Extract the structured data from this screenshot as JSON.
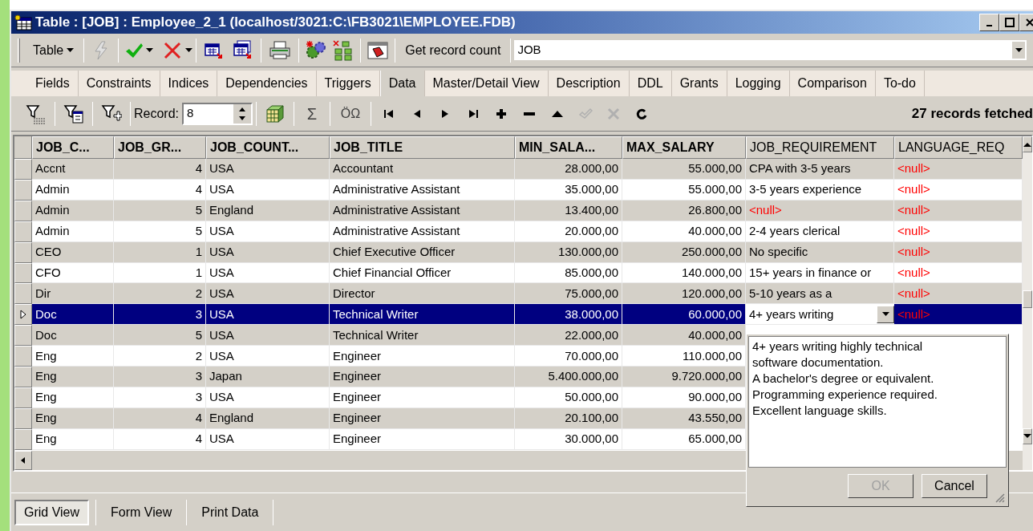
{
  "window": {
    "title": "Table : [JOB] : Employee_2_1 (localhost/3021:C:\\FB3021\\EMPLOYEE.FDB)"
  },
  "toolbar": {
    "table_menu": "Table",
    "lightning_disabled": true,
    "get_record_count": "Get record count",
    "table_select": "JOB"
  },
  "tabs": [
    {
      "label": "Fields",
      "selected": false
    },
    {
      "label": "Constraints",
      "selected": false
    },
    {
      "label": "Indices",
      "selected": false
    },
    {
      "label": "Dependencies",
      "selected": false
    },
    {
      "label": "Triggers",
      "selected": false
    },
    {
      "label": "Data",
      "selected": true
    },
    {
      "label": "Master/Detail View",
      "selected": false
    },
    {
      "label": "Description",
      "selected": false
    },
    {
      "label": "DDL",
      "selected": false
    },
    {
      "label": "Grants",
      "selected": false
    },
    {
      "label": "Logging",
      "selected": false
    },
    {
      "label": "Comparison",
      "selected": false
    },
    {
      "label": "To-do",
      "selected": false
    }
  ],
  "data_toolbar": {
    "record_label": "Record:",
    "record_value": "8",
    "sum": "Σ",
    "charset": "ÖΩ",
    "nav_buttons": [
      {
        "disabled": false
      },
      {
        "disabled": false
      },
      {
        "disabled": false
      },
      {
        "disabled": false
      },
      {
        "disabled": false
      },
      {
        "disabled": false
      },
      {
        "disabled": false
      },
      {
        "disabled": true
      },
      {
        "disabled": true
      },
      {
        "disabled": false
      }
    ],
    "status": "27 records fetched"
  },
  "table": {
    "columns": [
      {
        "label": "JOB_C...",
        "kind": "text"
      },
      {
        "label": "JOB_GR...",
        "kind": "number"
      },
      {
        "label": "JOB_COUNT...",
        "kind": "text"
      },
      {
        "label": "JOB_TITLE",
        "kind": "text"
      },
      {
        "label": "MIN_SALA...",
        "kind": "number"
      },
      {
        "label": "MAX_SALARY",
        "kind": "number"
      },
      {
        "label": "JOB_REQUIREMENT",
        "kind": "memo"
      },
      {
        "label": "LANGUAGE_REQ",
        "kind": "memo"
      }
    ],
    "rows": [
      {
        "selected": false,
        "cells": [
          "Accnt",
          "4",
          "USA",
          "Accountant",
          "28.000,00",
          "55.000,00"
        ],
        "memo_cells": [
          {
            "text": "CPA with 3-5 years",
            "null": false
          },
          {
            "text": "<null>",
            "null": true
          }
        ]
      },
      {
        "selected": false,
        "cells": [
          "Admin",
          "4",
          "USA",
          "Administrative Assistant",
          "35.000,00",
          "55.000,00"
        ],
        "memo_cells": [
          {
            "text": "3-5 years experience",
            "null": false
          },
          {
            "text": "<null>",
            "null": true
          }
        ]
      },
      {
        "selected": false,
        "cells": [
          "Admin",
          "5",
          "England",
          "Administrative Assistant",
          "13.400,00",
          "26.800,00"
        ],
        "memo_cells": [
          {
            "text": "<null>",
            "null": true
          },
          {
            "text": "<null>",
            "null": true
          }
        ]
      },
      {
        "selected": false,
        "cells": [
          "Admin",
          "5",
          "USA",
          "Administrative Assistant",
          "20.000,00",
          "40.000,00"
        ],
        "memo_cells": [
          {
            "text": "2-4 years clerical",
            "null": false
          },
          {
            "text": "<null>",
            "null": true
          }
        ]
      },
      {
        "selected": false,
        "cells": [
          "CEO",
          "1",
          "USA",
          "Chief Executive Officer",
          "130.000,00",
          "250.000,00"
        ],
        "memo_cells": [
          {
            "text": "No specific",
            "null": false
          },
          {
            "text": "<null>",
            "null": true
          }
        ]
      },
      {
        "selected": false,
        "cells": [
          "CFO",
          "1",
          "USA",
          "Chief Financial Officer",
          "85.000,00",
          "140.000,00"
        ],
        "memo_cells": [
          {
            "text": "15+ years in finance or",
            "null": false
          },
          {
            "text": "<null>",
            "null": true
          }
        ]
      },
      {
        "selected": false,
        "cells": [
          "Dir",
          "2",
          "USA",
          "Director",
          "75.000,00",
          "120.000,00"
        ],
        "memo_cells": [
          {
            "text": "5-10 years as a",
            "null": false
          },
          {
            "text": "<null>",
            "null": true
          }
        ]
      },
      {
        "selected": true,
        "cells": [
          "Doc",
          "3",
          "USA",
          "Technical Writer",
          "38.000,00",
          "60.000,00"
        ],
        "memo_cells": [
          {
            "text": "4+ years writing",
            "null": false
          },
          {
            "text": "<null>",
            "null": true
          }
        ]
      },
      {
        "selected": false,
        "cells": [
          "Doc",
          "5",
          "USA",
          "Technical Writer",
          "22.000,00",
          "40.000,00"
        ]
      },
      {
        "selected": false,
        "cells": [
          "Eng",
          "2",
          "USA",
          "Engineer",
          "70.000,00",
          "110.000,00"
        ]
      },
      {
        "selected": false,
        "cells": [
          "Eng",
          "3",
          "Japan",
          "Engineer",
          "5.400.000,00",
          "9.720.000,00"
        ]
      },
      {
        "selected": false,
        "cells": [
          "Eng",
          "3",
          "USA",
          "Engineer",
          "50.000,00",
          "90.000,00"
        ]
      },
      {
        "selected": false,
        "cells": [
          "Eng",
          "4",
          "England",
          "Engineer",
          "20.100,00",
          "43.550,00"
        ]
      },
      {
        "selected": false,
        "cells": [
          "Eng",
          "4",
          "USA",
          "Engineer",
          "30.000,00",
          "65.000,00"
        ]
      }
    ]
  },
  "memo_popup": {
    "text": "4+ years writing highly technical\nsoftware documentation.\nA bachelor's degree or equivalent.\nProgramming experience required.\nExcellent language skills.",
    "buttons": [
      {
        "label": "OK",
        "disabled": true
      },
      {
        "label": "Cancel",
        "disabled": false
      }
    ]
  },
  "view_tabs": [
    {
      "label": "Grid View",
      "selected": true
    },
    {
      "label": "Form View",
      "selected": false
    },
    {
      "label": "Print Data",
      "selected": false
    }
  ]
}
